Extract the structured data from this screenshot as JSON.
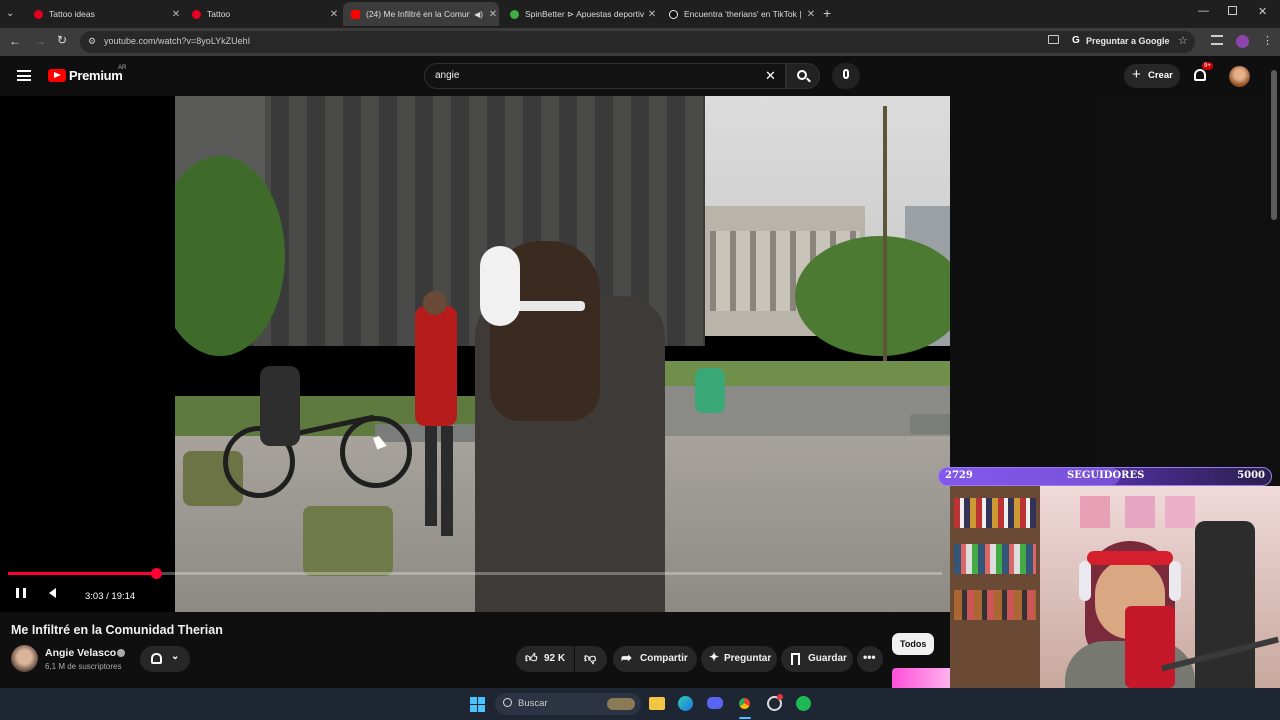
{
  "browser": {
    "tabs": [
      {
        "title": "Tattoo ideas",
        "icon": "pinterest-icon",
        "color": "#e60023"
      },
      {
        "title": "Tattoo",
        "icon": "pinterest-icon",
        "color": "#e60023"
      },
      {
        "title": "(24) Me Infiltré en la Comun",
        "icon": "youtube-icon",
        "color": "#ff0000"
      },
      {
        "title": "SpinBetter ⊳ Apuestas deportiv",
        "icon": "spinbetter-icon",
        "color": "#3cb043"
      },
      {
        "title": "Encuentra 'therians' en TikTok |",
        "icon": "tiktok-icon",
        "color": "#ffffff"
      }
    ],
    "url": "youtube.com/watch?v=8yoLYkZUehI",
    "ask_google": "Preguntar a Google"
  },
  "header": {
    "logo_text": "Premium",
    "region": "AR",
    "search_value": "angie",
    "create_label": "Crear",
    "notifications_badge": "9+"
  },
  "player": {
    "time": "3:03 / 19:14",
    "progress": 0.158
  },
  "video": {
    "title": "Me Infiltré en la Comunidad Therian",
    "channel": "Angie Velasco",
    "subscribers": "6,1 M de suscriptores",
    "likes": "92 K",
    "share": "Compartir",
    "ask": "Preguntar",
    "save": "Guardar"
  },
  "chips": {
    "all": "Todos"
  },
  "overlay": {
    "followers_current": "2729",
    "followers_label": "SEGUIDORES",
    "followers_goal": "5000",
    "progress": 0.546
  },
  "taskbar": {
    "search_placeholder": "Buscar"
  },
  "colors": {
    "accent_red": "#ff0033",
    "goal_purple": "#6b3fd6"
  }
}
